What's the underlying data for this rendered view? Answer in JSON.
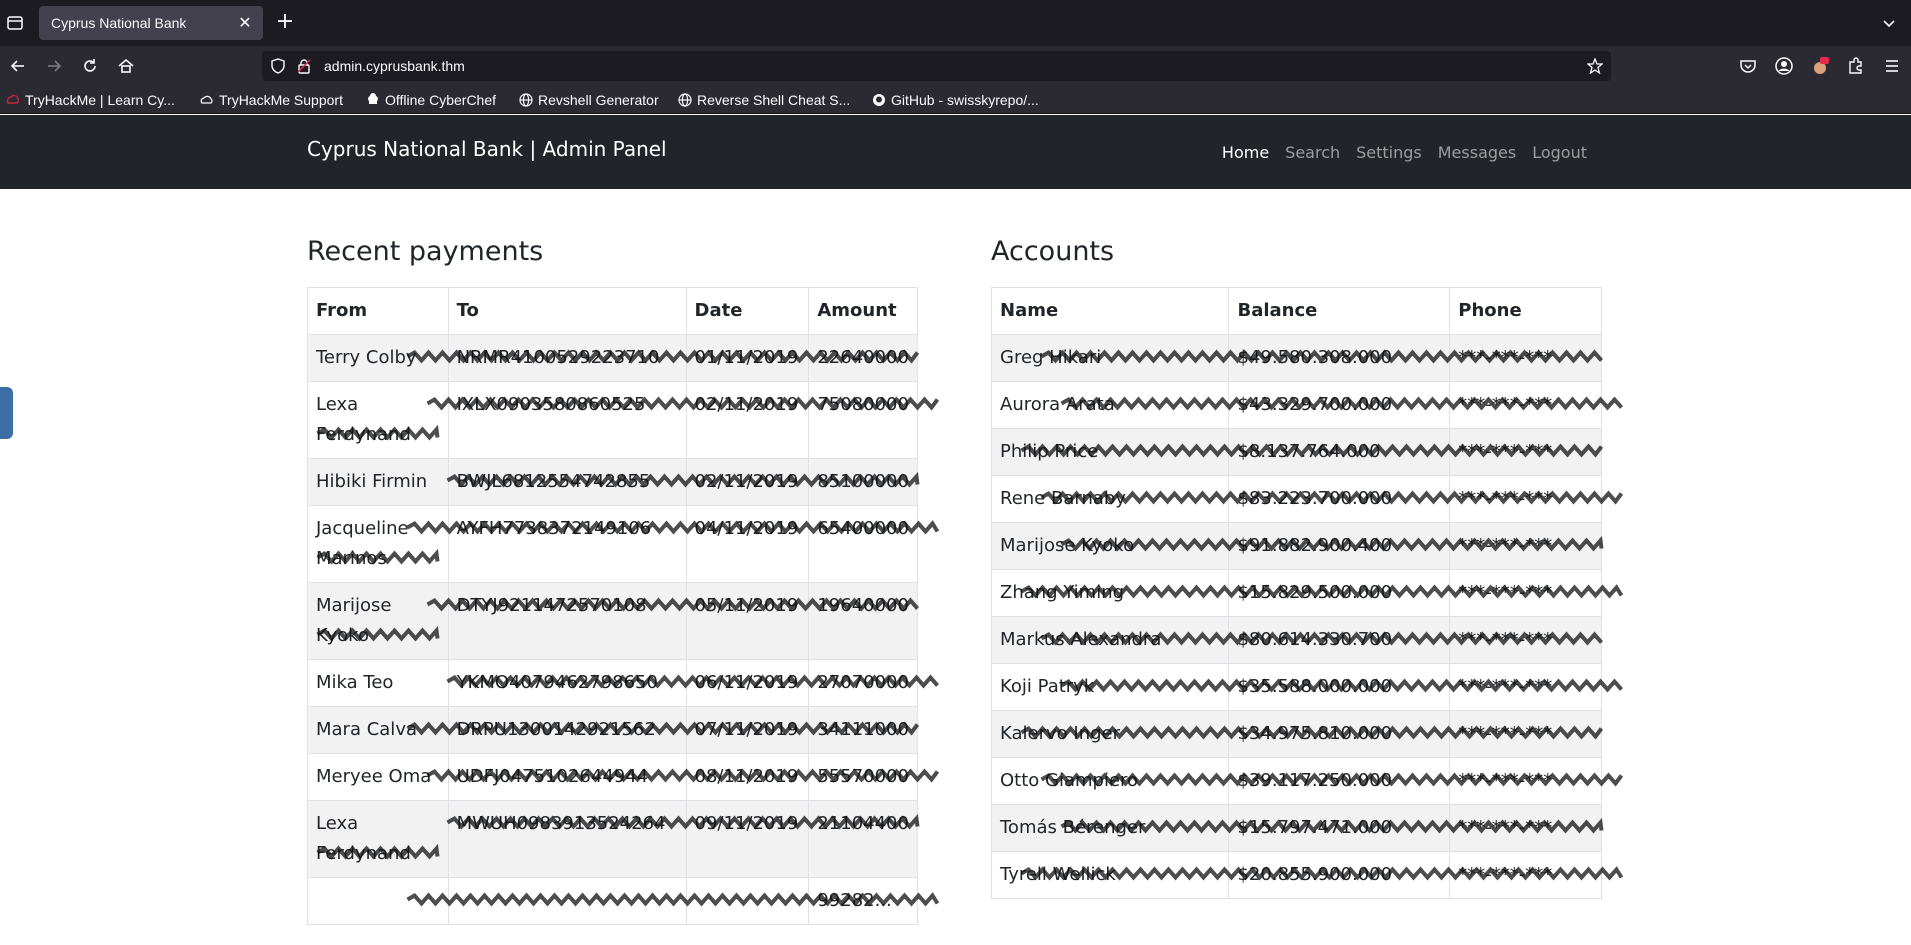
{
  "browser": {
    "tab_title": "Cyprus National Bank",
    "url_host": "admin.cyprusbank.thm",
    "bookmarks": [
      "TryHackMe | Learn Cy...",
      "TryHackMe Support",
      "Offline CyberChef",
      "Revshell Generator",
      "Reverse Shell Cheat S...",
      "GitHub - swisskyrepo/..."
    ]
  },
  "site": {
    "brand": "Cyprus National Bank | Admin Panel",
    "menu": [
      "Home",
      "Search",
      "Settings",
      "Messages",
      "Logout"
    ]
  },
  "payments": {
    "title": "Recent payments",
    "headers": [
      "From",
      "To",
      "Date",
      "Amount"
    ],
    "rows": [
      [
        "Terry Colby",
        "NRMR4100529223710",
        "01/11/2019",
        "22640000"
      ],
      [
        "Lexa Ferdynand",
        "IXLX0903580860525",
        "02/11/2019",
        "75080000"
      ],
      [
        "Hibiki Firmin",
        "BWJL6812554742855",
        "02/11/2019",
        "85100000"
      ],
      [
        "Jacqueline Marinos",
        "AYFH7738372149106",
        "04/11/2019",
        "65400000"
      ],
      [
        "Marijose Kyoko",
        "DTYJ9211472570108",
        "05/11/2019",
        "19640000"
      ],
      [
        "Mika Teo",
        "YKMO4079462798650",
        "06/11/2019",
        "27070000"
      ],
      [
        "Mara Calva",
        "DRPU1300142921562",
        "07/11/2019",
        "34111000"
      ],
      [
        "Meryee Oma",
        "UDFJ0475102644944",
        "08/11/2019",
        "55570000"
      ],
      [
        "Lexa Ferdynand",
        "MWUH0983913524264",
        "09/11/2019",
        "21104400"
      ],
      [
        "",
        "",
        "",
        "99282..."
      ]
    ]
  },
  "accounts": {
    "title": "Accounts",
    "headers": [
      "Name",
      "Balance",
      "Phone"
    ],
    "rows": [
      [
        "Greg Hikari",
        "$49.580.308.000",
        "***-***-***"
      ],
      [
        "Aurora Arata",
        "$43.329.700.000",
        "***-***-***"
      ],
      [
        "Philip Price",
        "$8.137.764.000",
        "***-***-***"
      ],
      [
        "Rene Barnaby",
        "$83.223.700.000",
        "***-***-***"
      ],
      [
        "Marijose Kyoko",
        "$91.882.900.400",
        "***-***-***"
      ],
      [
        "Zhang Yiming",
        "$15.829.500.000",
        "***-***-***"
      ],
      [
        "Markus Alexandra",
        "$80.614.330.700",
        "***-***-***"
      ],
      [
        "Koji Patryk",
        "$35.588.000.000",
        "***-***-***"
      ],
      [
        "Kalervo Inger",
        "$34.975.810.000",
        "***-***-***"
      ],
      [
        "Otto Giampiero",
        "$39.117.250.000",
        "***-***-***"
      ],
      [
        "Tomás Bérenger",
        "$15.797.471.000",
        "***-***-***"
      ],
      [
        "Tyrell Wellick",
        "$20.855.900.000",
        "***-***-***"
      ]
    ]
  }
}
